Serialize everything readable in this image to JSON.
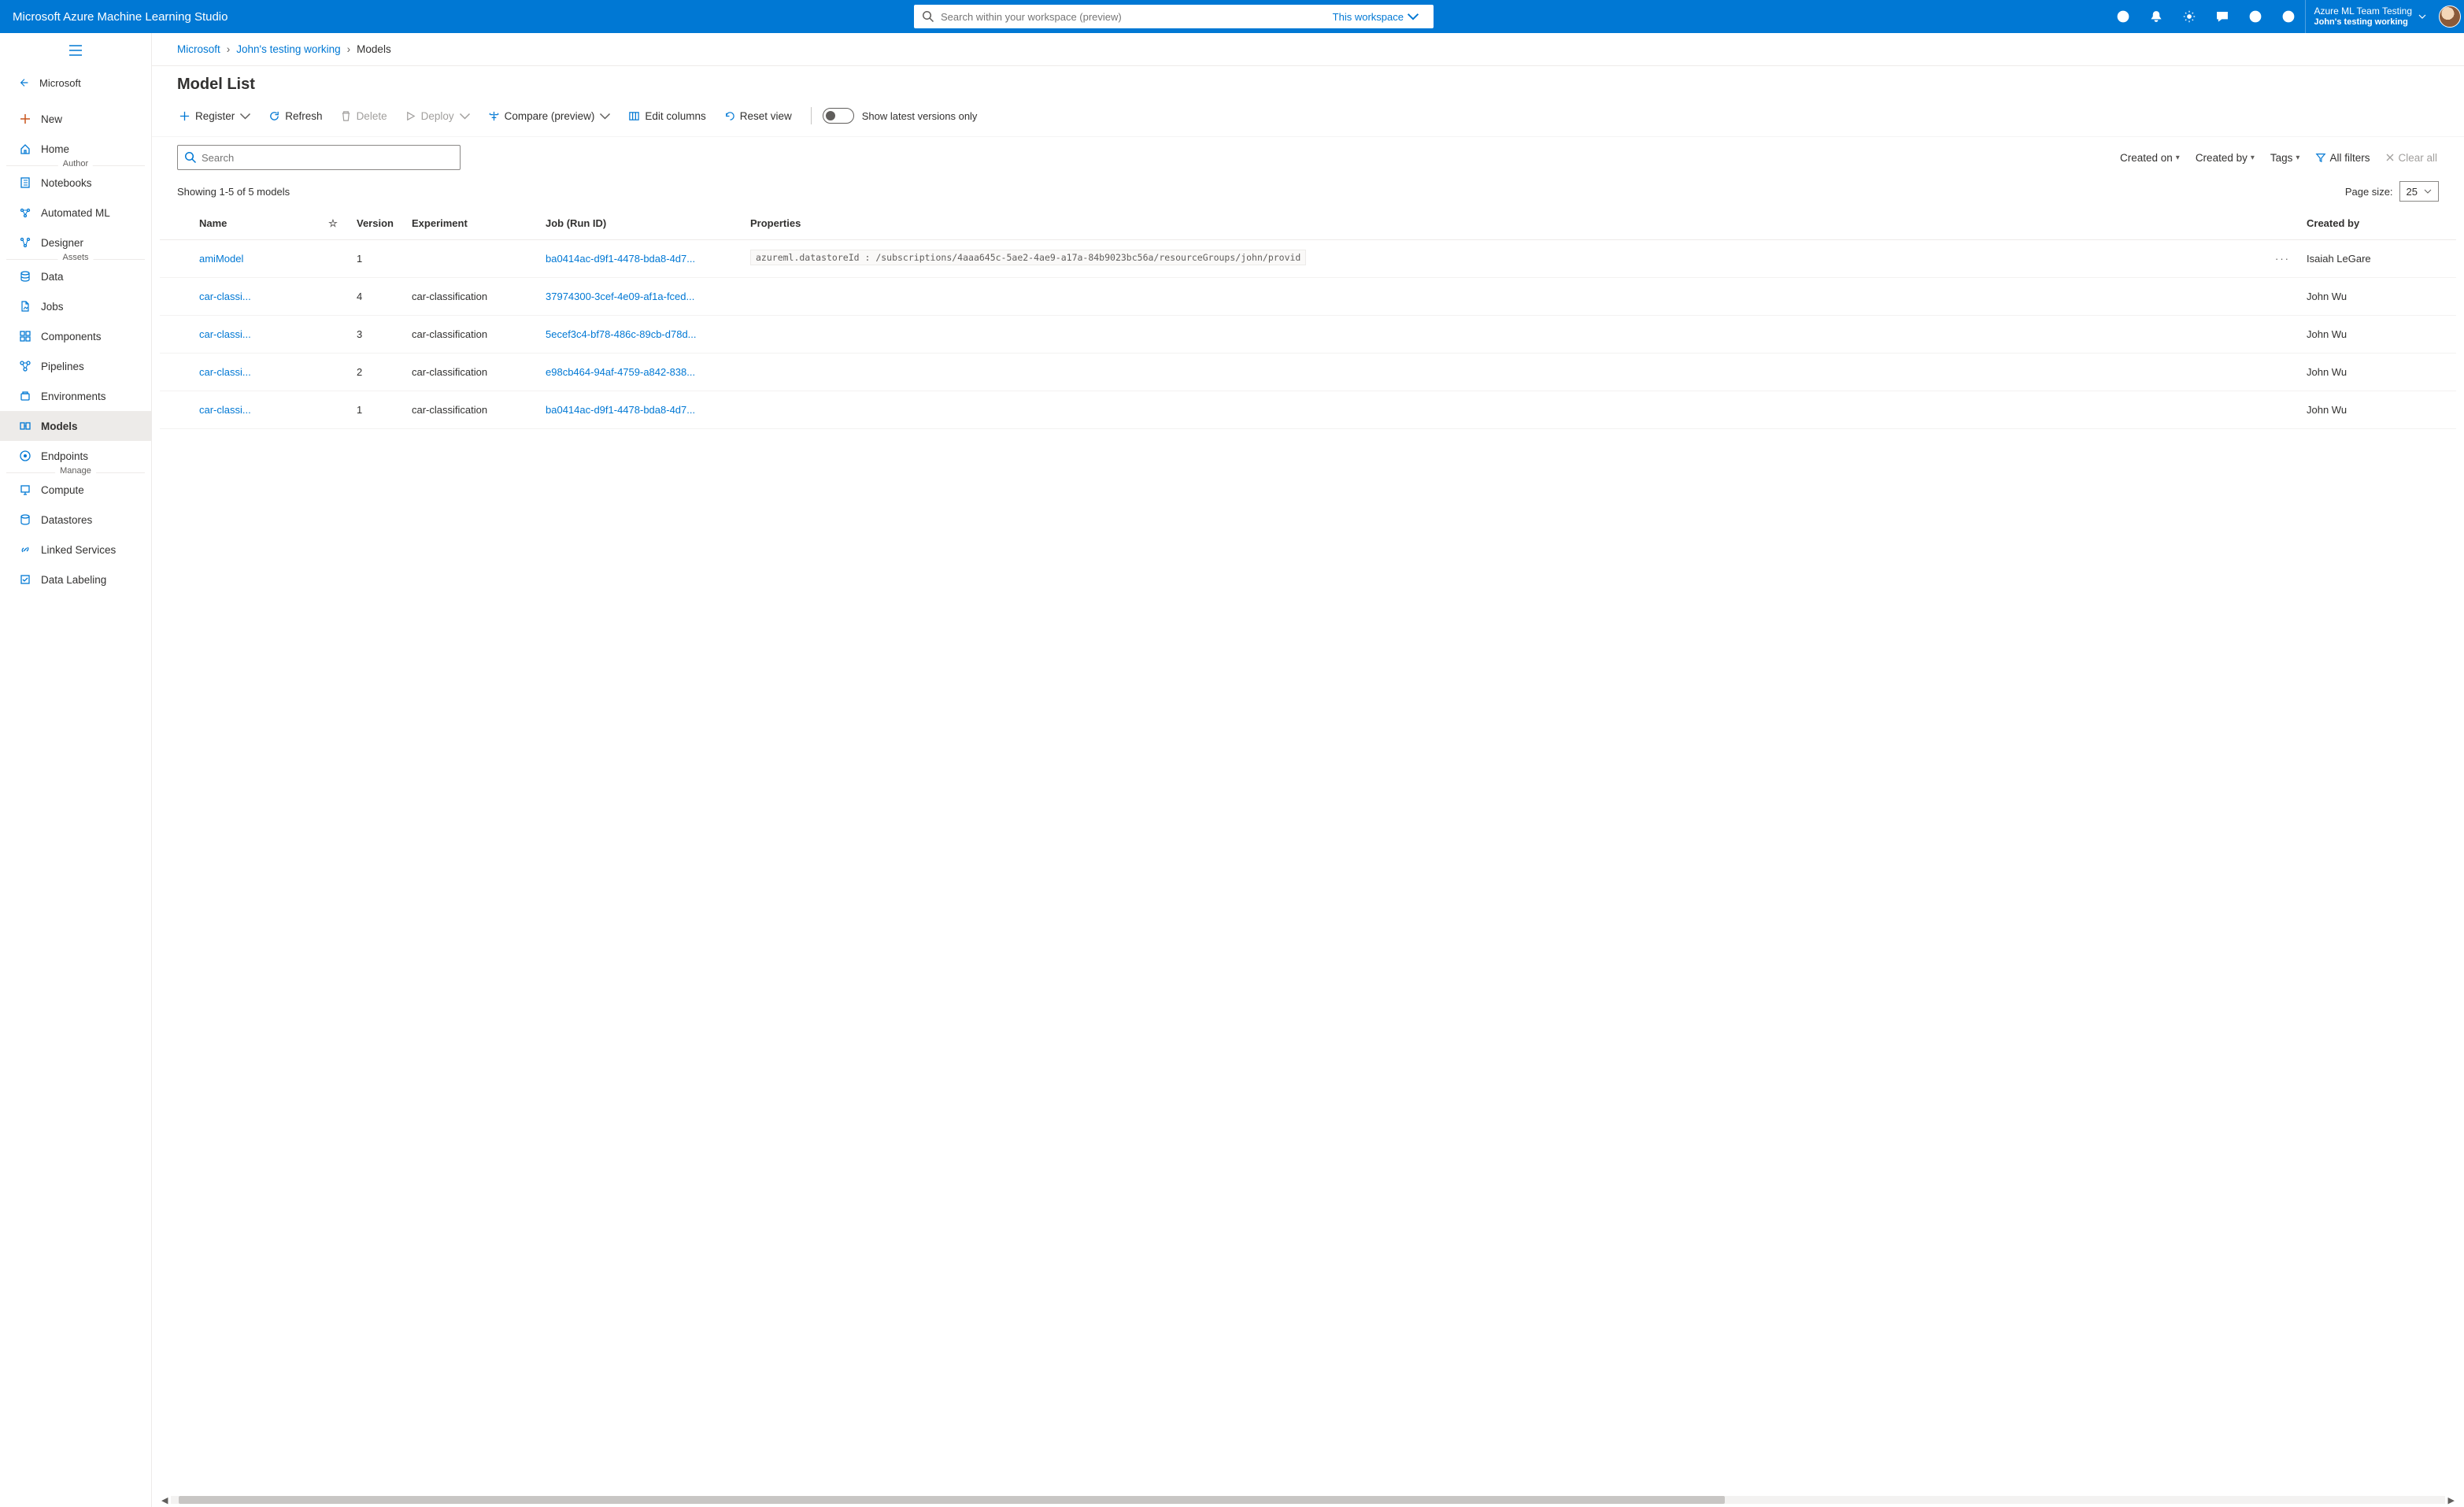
{
  "header": {
    "product": "Microsoft Azure Machine Learning Studio",
    "search_placeholder": "Search within your workspace (preview)",
    "scope_label": "This workspace",
    "tenant_line1": "Azure ML Team Testing",
    "tenant_line2": "John's testing working"
  },
  "sidebar": {
    "back_label": "Microsoft",
    "items_top": [
      {
        "icon": "plus",
        "label": "New"
      },
      {
        "icon": "home",
        "label": "Home"
      }
    ],
    "section_author": "Author",
    "items_author": [
      {
        "icon": "notebook",
        "label": "Notebooks"
      },
      {
        "icon": "automl",
        "label": "Automated ML"
      },
      {
        "icon": "designer",
        "label": "Designer"
      }
    ],
    "section_assets": "Assets",
    "items_assets": [
      {
        "icon": "data",
        "label": "Data"
      },
      {
        "icon": "jobs",
        "label": "Jobs"
      },
      {
        "icon": "components",
        "label": "Components"
      },
      {
        "icon": "pipelines",
        "label": "Pipelines"
      },
      {
        "icon": "environments",
        "label": "Environments"
      },
      {
        "icon": "models",
        "label": "Models",
        "active": true
      },
      {
        "icon": "endpoints",
        "label": "Endpoints"
      }
    ],
    "section_manage": "Manage",
    "items_manage": [
      {
        "icon": "compute",
        "label": "Compute"
      },
      {
        "icon": "datastores",
        "label": "Datastores"
      },
      {
        "icon": "linked",
        "label": "Linked Services"
      },
      {
        "icon": "labeling",
        "label": "Data Labeling"
      }
    ]
  },
  "breadcrumbs": {
    "items": [
      "Microsoft",
      "John's testing working",
      "Models"
    ]
  },
  "page": {
    "title": "Model List"
  },
  "toolbar": {
    "register": "Register",
    "refresh": "Refresh",
    "delete": "Delete",
    "deploy": "Deploy",
    "compare": "Compare (preview)",
    "edit_columns": "Edit columns",
    "reset_view": "Reset view",
    "show_latest": "Show latest versions only"
  },
  "filters": {
    "search_placeholder": "Search",
    "created_on": "Created on",
    "created_by": "Created by",
    "tags": "Tags",
    "all_filters": "All filters",
    "clear_all": "Clear all"
  },
  "results": {
    "count_text": "Showing 1-5 of 5 models",
    "page_size_label": "Page size:",
    "page_size_value": "25"
  },
  "table": {
    "headers": {
      "name": "Name",
      "version": "Version",
      "experiment": "Experiment",
      "job": "Job (Run ID)",
      "properties": "Properties",
      "created_by": "Created by"
    },
    "rows": [
      {
        "name": "amiModel",
        "version": "1",
        "experiment": "",
        "job": "ba0414ac-d9f1-4478-bda8-4d7...",
        "properties": "azureml.datastoreId : /subscriptions/4aaa645c-5ae2-4ae9-a17a-84b9023bc56a/resourceGroups/john/provid",
        "show_menu": true,
        "created_by": "Isaiah LeGare"
      },
      {
        "name": "car-classi...",
        "version": "4",
        "experiment": "car-classification",
        "job": "37974300-3cef-4e09-af1a-fced...",
        "properties": "",
        "created_by": "John Wu"
      },
      {
        "name": "car-classi...",
        "version": "3",
        "experiment": "car-classification",
        "job": "5ecef3c4-bf78-486c-89cb-d78d...",
        "properties": "",
        "created_by": "John Wu"
      },
      {
        "name": "car-classi...",
        "version": "2",
        "experiment": "car-classification",
        "job": "e98cb464-94af-4759-a842-838...",
        "properties": "",
        "created_by": "John Wu"
      },
      {
        "name": "car-classi...",
        "version": "1",
        "experiment": "car-classification",
        "job": "ba0414ac-d9f1-4478-bda8-4d7...",
        "properties": "",
        "created_by": "John Wu"
      }
    ]
  }
}
